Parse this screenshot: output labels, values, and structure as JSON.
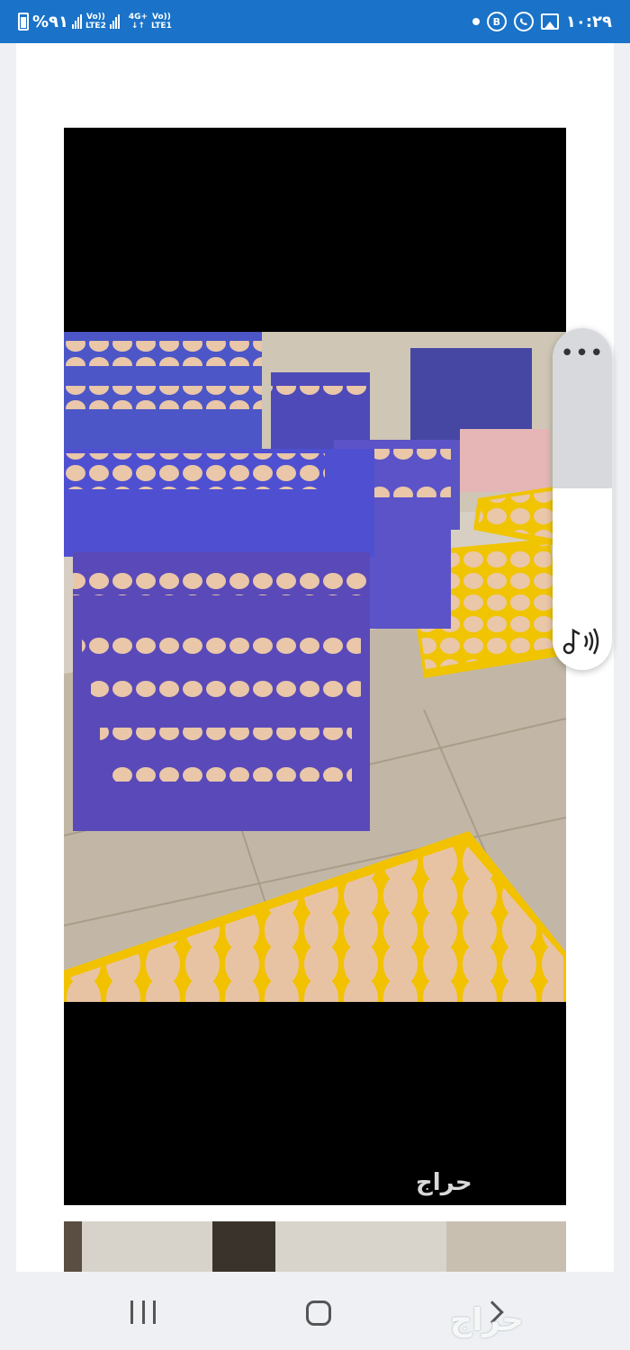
{
  "status_bar": {
    "battery_percent": "%٩١",
    "sim1_label_top": "Vo))",
    "sim1_label_bottom": "LTE2",
    "sim2_label_top_left": "4G+",
    "sim2_label_bottom_left": "↓↑",
    "sim2_label_top": "Vo))",
    "sim2_label_bottom": "LTE1",
    "notif_b_letter": "B",
    "time": "١٠:٢٩",
    "icons": [
      "battery-icon",
      "signal-icon",
      "signal-icon",
      "dot-icon",
      "b-badge-icon",
      "whatsapp-icon",
      "gallery-icon"
    ]
  },
  "photo": {
    "watermark": "حراج",
    "description_icon": "eggs-photo"
  },
  "float_panel": {
    "menu_glyph": "•••",
    "sound_icon": "music-note-sound-icon"
  },
  "nav": {
    "logo": "حراج",
    "icons": [
      "recents-icon",
      "home-icon",
      "back-icon"
    ]
  }
}
